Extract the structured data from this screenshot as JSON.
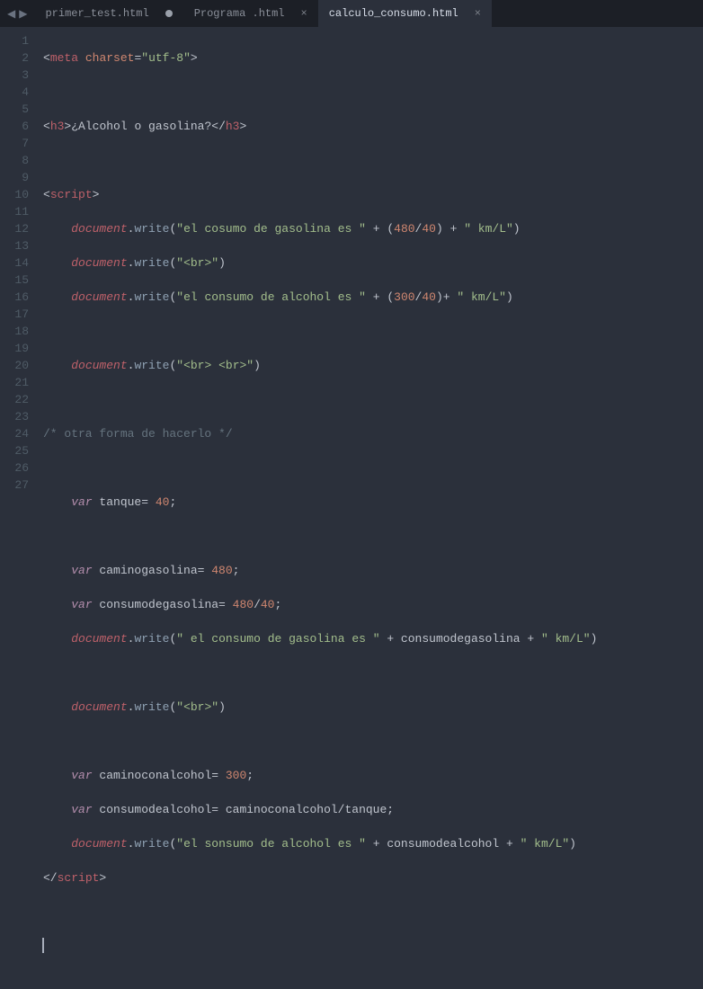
{
  "tabs": [
    {
      "label": "primer_test.html",
      "state": "dirty",
      "active": false
    },
    {
      "label": "Programa .html",
      "state": "clean",
      "active": false
    },
    {
      "label": "calculo_consumo.html",
      "state": "clean",
      "active": true
    }
  ],
  "line_count": 27,
  "code": {
    "l1_tag_open": "<",
    "l1_tag": "meta",
    "l1_attr": "charset",
    "l1_eq": "=",
    "l1_val": "\"utf-8\"",
    "l1_tag_close": ">",
    "l3_open": "<",
    "l3_tag": "h3",
    "l3_gt": ">",
    "l3_text": "¿Alcohol o gasolina?",
    "l3_close_open": "</",
    "l3_close_tag": "h3",
    "l3_close_gt": ">",
    "l5_open": "<",
    "l5_tag": "script",
    "l5_gt": ">",
    "l6_obj": "document",
    "l6_dot": ".",
    "l6_m": "write",
    "l6_lp": "(",
    "l6_s1": "\"el cosumo de gasolina es \"",
    "l6_p1": " + (",
    "l6_n1": "480",
    "l6_slash": "/",
    "l6_n2": "40",
    "l6_p2": ") + ",
    "l6_s2": "\" km/L\"",
    "l6_rp": ")",
    "l7_obj": "document",
    "l7_dot": ".",
    "l7_m": "write",
    "l7_lp": "(",
    "l7_s": "\"<br>\"",
    "l7_rp": ")",
    "l8_obj": "document",
    "l8_dot": ".",
    "l8_m": "write",
    "l8_lp": "(",
    "l8_s1": "\"el consumo de alcohol es \"",
    "l8_p1": " + (",
    "l8_n1": "300",
    "l8_slash": "/",
    "l8_n2": "40",
    "l8_p2": ")+ ",
    "l8_s2": "\" km/L\"",
    "l8_rp": ")",
    "l10_obj": "document",
    "l10_dot": ".",
    "l10_m": "write",
    "l10_lp": "(",
    "l10_s": "\"<br> <br>\"",
    "l10_rp": ")",
    "l12_cmt": "/* otra forma de hacerlo */",
    "l14_var": "var",
    "l14_id": " tanque= ",
    "l14_n": "40",
    "l14_sc": ";",
    "l16_var": "var",
    "l16_id": " caminogasolina= ",
    "l16_n": "480",
    "l16_sc": ";",
    "l17_var": "var",
    "l17_id": " consumodegasolina= ",
    "l17_n1": "480",
    "l17_slash": "/",
    "l17_n2": "40",
    "l17_sc": ";",
    "l18_obj": "document",
    "l18_dot": ".",
    "l18_m": "write",
    "l18_lp": "(",
    "l18_s1": "\" el consumo de gasolina es \"",
    "l18_p1": " + consumodegasolina + ",
    "l18_s2": "\" km/L\"",
    "l18_rp": ")",
    "l20_obj": "document",
    "l20_dot": ".",
    "l20_m": "write",
    "l20_lp": "(",
    "l20_s": "\"<br>\"",
    "l20_rp": ")",
    "l22_var": "var",
    "l22_id": " caminoconalcohol= ",
    "l22_n": "300",
    "l22_sc": ";",
    "l23_var": "var",
    "l23_id": " consumodealcohol= caminoconalcohol/tanque;",
    "l24_obj": "document",
    "l24_dot": ".",
    "l24_m": "write",
    "l24_lp": "(",
    "l24_s1": "\"el sonsumo de alcohol es \"",
    "l24_p1": " + consumodealcohol + ",
    "l24_s2": "\" km/L\"",
    "l24_rp": ")",
    "l25_open": "</",
    "l25_tag": "script",
    "l25_gt": ">"
  }
}
